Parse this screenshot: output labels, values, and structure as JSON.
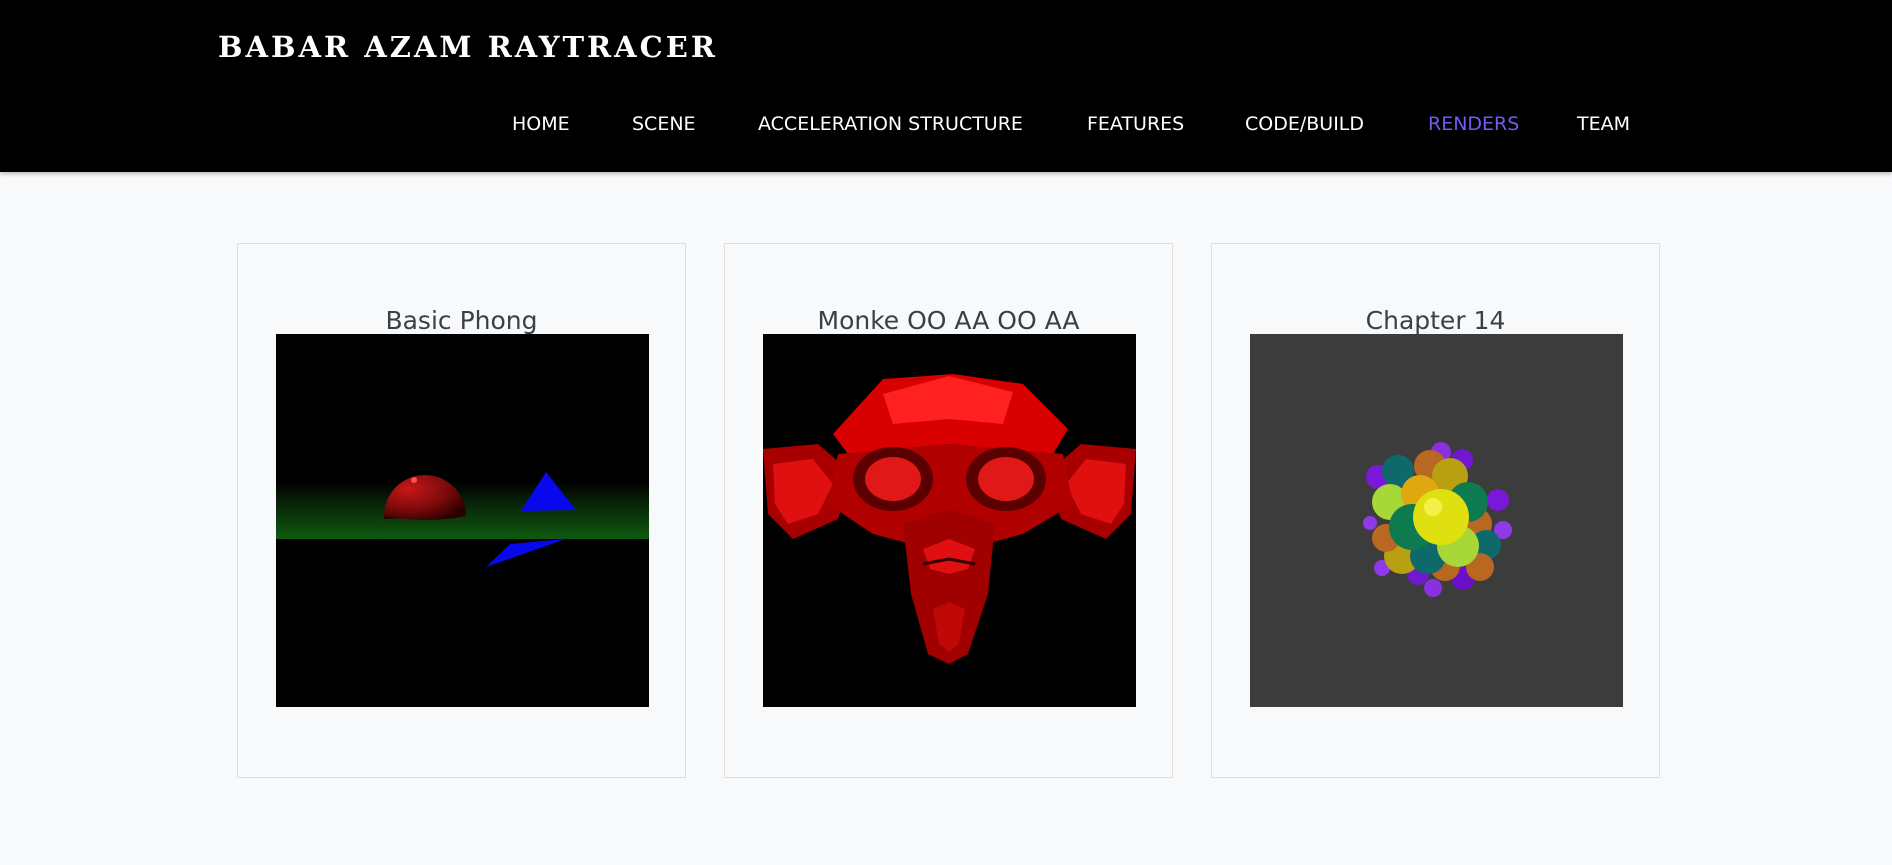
{
  "header": {
    "brand": "BABAR AZAM RAYTRACER"
  },
  "nav": {
    "items": [
      {
        "label": "HOME"
      },
      {
        "label": "SCENE"
      },
      {
        "label": "ACCELERATION STRUCTURE"
      },
      {
        "label": "FEATURES"
      },
      {
        "label": "CODE/BUILD"
      },
      {
        "label": "RENDERS",
        "active": true
      },
      {
        "label": "TEAM"
      }
    ]
  },
  "renders": [
    {
      "title": "Basic Phong",
      "image": "phong-scene-render"
    },
    {
      "title": "Monke OO AA OO AA",
      "image": "monkey-head-render"
    },
    {
      "title": "Chapter 14",
      "image": "sphere-cluster-render"
    }
  ],
  "colors": {
    "accent": "#6f5cf0",
    "header_bg": "#000000",
    "page_bg": "#f8f9fa"
  }
}
